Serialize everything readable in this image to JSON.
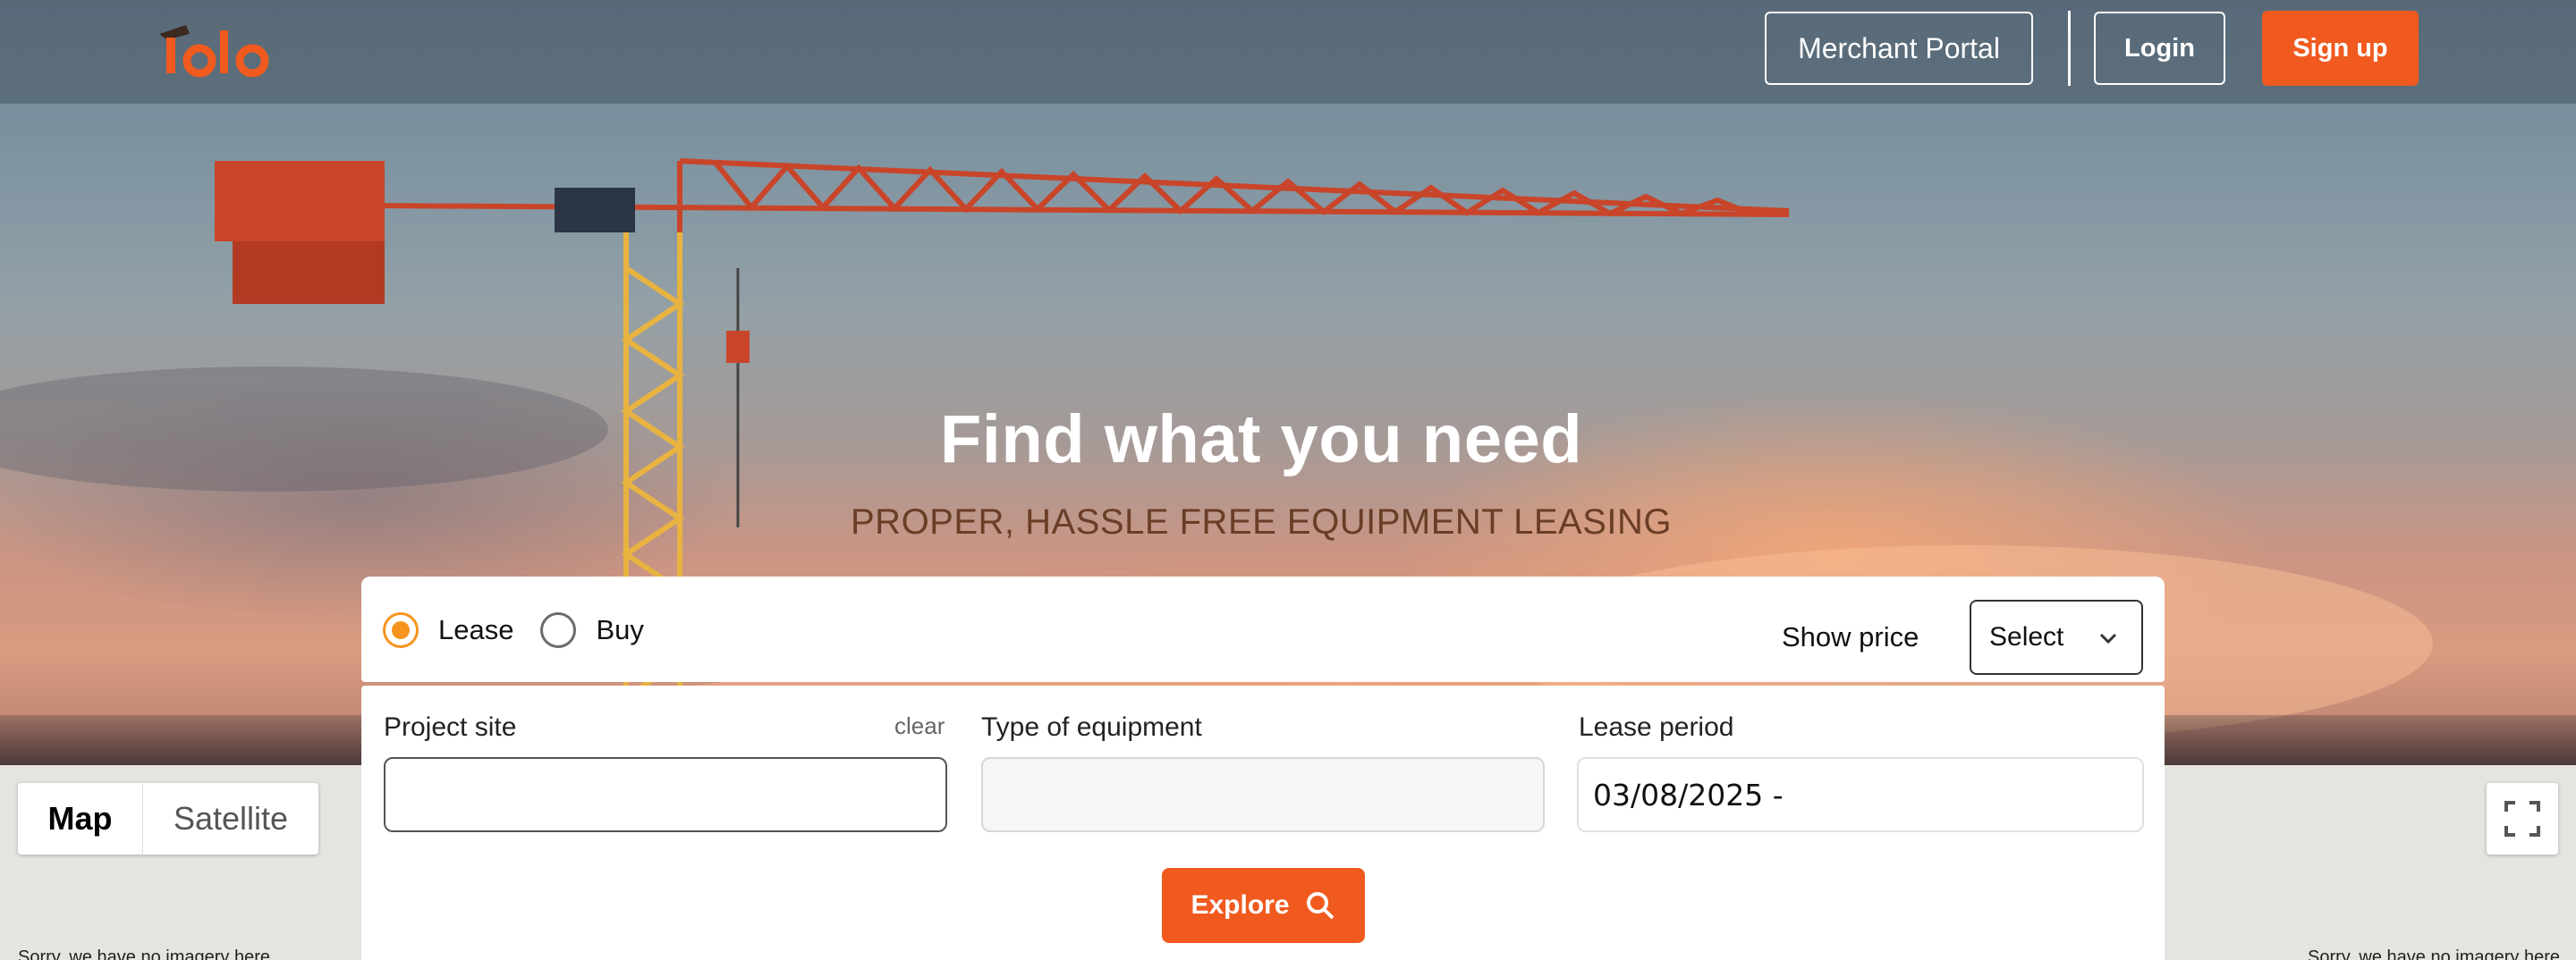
{
  "header": {
    "logo_text": "Tolo",
    "merchant_portal_label": "Merchant Portal",
    "login_label": "Login",
    "signup_label": "Sign up"
  },
  "hero": {
    "title": "Find what you need",
    "subtitle": "PROPER, HASSLE FREE EQUIPMENT LEASING"
  },
  "search": {
    "mode_options": [
      {
        "label": "Lease",
        "selected": true
      },
      {
        "label": "Buy",
        "selected": false
      }
    ],
    "show_price_label": "Show price",
    "price_select_value": "Select",
    "project_site": {
      "label": "Project site",
      "clear_label": "clear",
      "value": ""
    },
    "equipment_type": {
      "label": "Type of equipment",
      "value": ""
    },
    "lease_period": {
      "label": "Lease period",
      "value": "03/08/2025 -"
    },
    "explore_label": "Explore"
  },
  "map": {
    "map_tab_label": "Map",
    "satellite_tab_label": "Satellite",
    "no_imagery_text": "Sorry, we have no imagery here."
  },
  "colors": {
    "brand_orange": "#f05a1e",
    "radio_accent": "#f7941e"
  },
  "icons": {
    "search": "search-icon",
    "fullscreen": "fullscreen-icon",
    "chevron": "chevron-down-icon"
  }
}
